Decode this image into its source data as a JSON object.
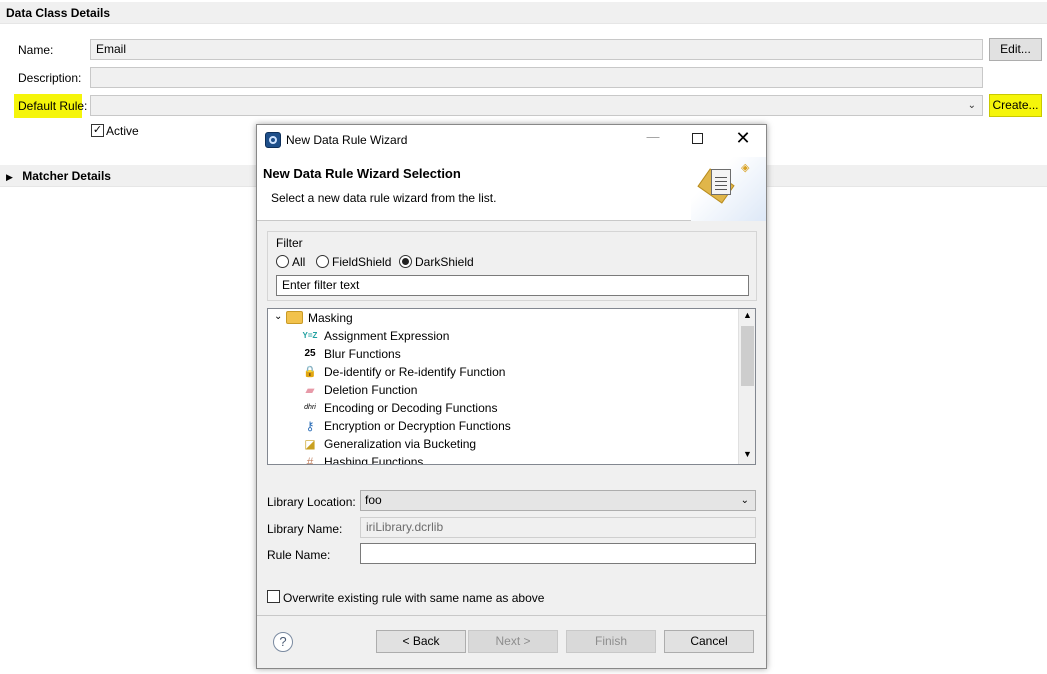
{
  "data_class": {
    "section_title": "Data Class Details",
    "name_label": "Name:",
    "name_value": "Email",
    "edit_label": "Edit...",
    "description_label": "Description:",
    "description_value": "",
    "default_rule_label": "Default Rule:",
    "default_rule_value": "",
    "create_label": "Create...",
    "active_label": "Active",
    "active_checked": true,
    "highlight_color": "#f5f50a"
  },
  "matcher": {
    "section_title": "Matcher Details"
  },
  "dialog": {
    "title": "New Data Rule Wizard",
    "heading": "New Data Rule Wizard Selection",
    "subheading": "Select a new data rule wizard from the list.",
    "filter": {
      "group_label": "Filter",
      "options": [
        "All",
        "FieldShield",
        "DarkShield"
      ],
      "selected": "DarkShield",
      "input_value": "Enter filter text"
    },
    "tree": {
      "root": "Masking",
      "items": [
        {
          "label": "Assignment Expression",
          "icon": "assignment-icon",
          "glyph": "Y=Z"
        },
        {
          "label": "Blur Functions",
          "icon": "blur-icon",
          "glyph": "25"
        },
        {
          "label": "De-identify or Re-identify Function",
          "icon": "lock-icon",
          "glyph": "🔒"
        },
        {
          "label": "Deletion Function",
          "icon": "eraser-icon",
          "glyph": "▰"
        },
        {
          "label": "Encoding or Decoding Functions",
          "icon": "encoding-icon",
          "glyph": "dhri"
        },
        {
          "label": "Encryption or Decryption Functions",
          "icon": "key-icon",
          "glyph": "⚷"
        },
        {
          "label": "Generalization via Bucketing",
          "icon": "bucket-icon",
          "glyph": "◪"
        },
        {
          "label": "Hashing Functions",
          "icon": "hash-icon",
          "glyph": "#"
        }
      ]
    },
    "library_location_label": "Library Location:",
    "library_location_value": "foo",
    "library_name_label": "Library Name:",
    "library_name_value": "iriLibrary.dcrlib",
    "rule_name_label": "Rule Name:",
    "rule_name_value": "",
    "overwrite_label": "Overwrite existing rule with same name as above",
    "overwrite_checked": false,
    "buttons": {
      "back": "< Back",
      "next": "Next >",
      "finish": "Finish",
      "cancel": "Cancel",
      "help": "?"
    }
  }
}
